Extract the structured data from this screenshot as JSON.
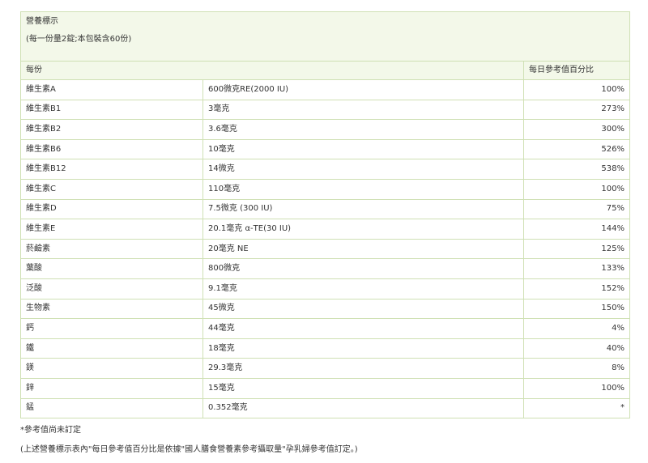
{
  "title": "營養標示",
  "serving_info": "(每一份量2錠;本包裝含60份)",
  "header": {
    "per_serving": "每份",
    "daily_value_pct": "每日參考值百分比"
  },
  "rows": [
    {
      "nutrient": "維生素A",
      "amount": "600微克RE(2000 IU)",
      "dv": "100%"
    },
    {
      "nutrient": "維生素B1",
      "amount": "3毫克",
      "dv": "273%"
    },
    {
      "nutrient": "維生素B2",
      "amount": "3.6毫克",
      "dv": "300%"
    },
    {
      "nutrient": "維生素B6",
      "amount": "10毫克",
      "dv": "526%"
    },
    {
      "nutrient": "維生素B12",
      "amount": "14微克",
      "dv": "538%"
    },
    {
      "nutrient": "維生素C",
      "amount": "110毫克",
      "dv": "100%"
    },
    {
      "nutrient": "維生素D",
      "amount": "7.5微克 (300 IU)",
      "dv": "75%"
    },
    {
      "nutrient": "維生素E",
      "amount": "20.1毫克 α-TE(30 IU)",
      "dv": "144%"
    },
    {
      "nutrient": "菸鹼素",
      "amount": "20毫克 NE",
      "dv": "125%"
    },
    {
      "nutrient": "葉酸",
      "amount": "800微克",
      "dv": "133%"
    },
    {
      "nutrient": "泛酸",
      "amount": "9.1毫克",
      "dv": "152%"
    },
    {
      "nutrient": "生物素",
      "amount": "45微克",
      "dv": "150%"
    },
    {
      "nutrient": "鈣",
      "amount": "44毫克",
      "dv": "4%"
    },
    {
      "nutrient": "鐵",
      "amount": "18毫克",
      "dv": "40%"
    },
    {
      "nutrient": "鎂",
      "amount": "29.3毫克",
      "dv": "8%"
    },
    {
      "nutrient": "鋅",
      "amount": "15毫克",
      "dv": "100%"
    },
    {
      "nutrient": "錳",
      "amount": "0.352毫克",
      "dv": "*"
    }
  ],
  "footnotes": {
    "asterisk_note": "*參考值尚未訂定",
    "source_note": "(上述營養標示表內\"每日參考值百分比是依據\"國人膳食營養素參考攝取量\"孕乳婦參考值訂定。)"
  }
}
